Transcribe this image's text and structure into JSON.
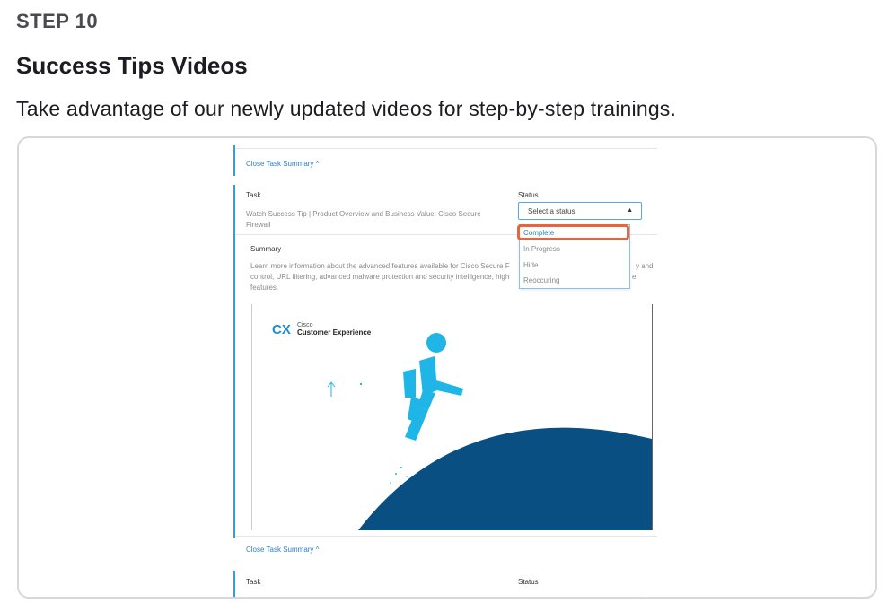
{
  "header": {
    "step": "STEP 10",
    "title": "Success Tips Videos",
    "description": "Take advantage of our newly updated videos for step-by-step trainings."
  },
  "screenshot": {
    "close_summary_top": "Close Task Summary ^",
    "task_label": "Task",
    "status_label": "Status",
    "task_text": "Watch Success Tip | Product Overview and Business Value: Cisco Secure Firewall",
    "select_placeholder": "Select a status",
    "select_caret": "▲",
    "options": [
      "Complete",
      "In Progress",
      "Hide",
      "Reoccuring"
    ],
    "summary_label": "Summary",
    "summary_text_left": "Learn more information about the advanced features available for Cisco Secure F",
    "summary_text_left_2": "control, URL filtering, advanced malware protection and security intelligence, high",
    "summary_text_left_3": "features.",
    "summary_text_right": "y and",
    "summary_text_right_2": "e",
    "video": {
      "logo_mark": "CX",
      "brand": "Cisco",
      "brand_sub": "Customer Experience"
    },
    "close_summary_bottom": "Close Task Summary ^",
    "task_label_2": "Task",
    "status_label_2": "Status",
    "colors": {
      "accent": "#2aa3dc",
      "link": "#2a7fc9",
      "highlight": "#e9643a",
      "figure": "#1fb5e6",
      "hill": "#0a4f82"
    }
  }
}
